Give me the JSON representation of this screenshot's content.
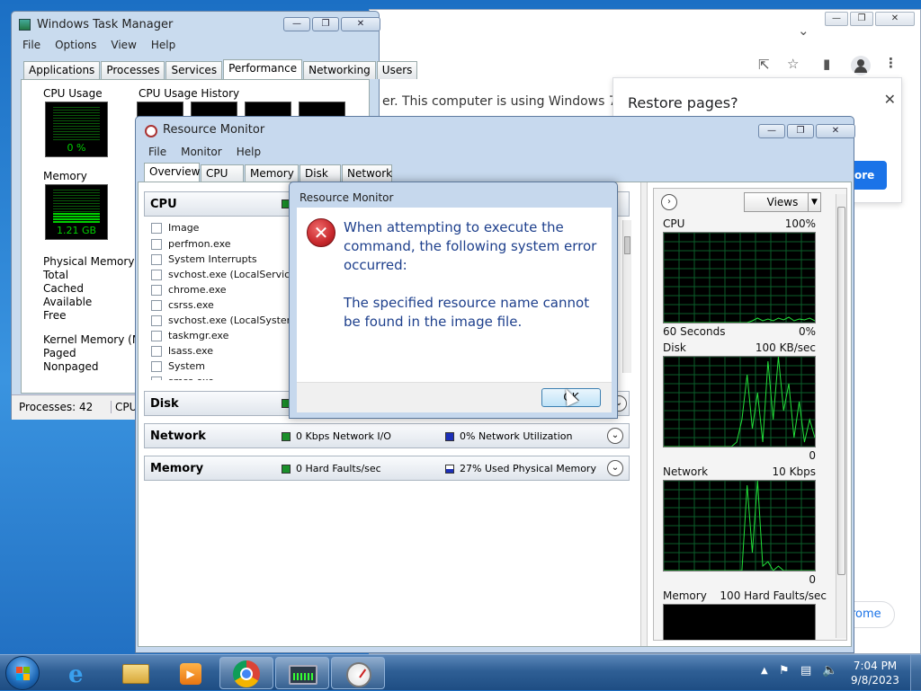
{
  "chrome": {
    "page_text": "er. This computer is using Windows 7.",
    "restore_title": "Restore pages?",
    "restore_btn": "ore",
    "bottom_btn": "rome",
    "controls": {
      "min": "—",
      "max": "❐",
      "close": "✕"
    }
  },
  "task_manager": {
    "title": "Windows Task Manager",
    "menu": [
      "File",
      "Options",
      "View",
      "Help"
    ],
    "tabs": [
      "Applications",
      "Processes",
      "Services",
      "Performance",
      "Networking",
      "Users"
    ],
    "active_tab": "Performance",
    "cpu_usage_label": "CPU Usage",
    "cpu_usage_value": "0 %",
    "cpu_history_label": "CPU Usage History",
    "memory_label": "Memory",
    "memory_value": "1.21 GB",
    "physical_memory": {
      "label": "Physical Memory (MB)",
      "rows": [
        "Total",
        "Cached",
        "Available",
        "Free"
      ]
    },
    "kernel_memory": {
      "label": "Kernel Memory (MB)",
      "rows": [
        "Paged",
        "Nonpaged"
      ]
    },
    "status_processes": "Processes: 42",
    "status_cpu": "CPU"
  },
  "resource_monitor": {
    "title": "Resource Monitor",
    "menu": [
      "File",
      "Monitor",
      "Help"
    ],
    "tabs": [
      "Overview",
      "CPU",
      "Memory",
      "Disk",
      "Network"
    ],
    "active_tab": "Overview",
    "cpu_section": "CPU",
    "image_col": "Image",
    "processes": [
      "perfmon.exe",
      "System Interrupts",
      "svchost.exe (LocalServiceNo",
      "chrome.exe",
      "csrss.exe",
      "svchost.exe (LocalSystemNe",
      "taskmgr.exe",
      "lsass.exe",
      "System",
      "smss.exe"
    ],
    "disk_section": "Disk",
    "network_section": "Network",
    "network_io": "0 Kbps Network I/O",
    "network_util": "0% Network Utilization",
    "memory_section": "Memory",
    "hard_faults": "0 Hard Faults/sec",
    "used_phys": "27% Used Physical Memory",
    "views_btn": "Views",
    "graphs": [
      {
        "name": "CPU",
        "scale": "100%",
        "bottom_left": "60 Seconds",
        "bottom_right": "0%"
      },
      {
        "name": "Disk",
        "scale": "100 KB/sec",
        "bottom_left": "",
        "bottom_right": "0"
      },
      {
        "name": "Network",
        "scale": "10 Kbps",
        "bottom_left": "",
        "bottom_right": "0"
      },
      {
        "name": "Memory",
        "scale": "100 Hard Faults/sec",
        "bottom_left": "",
        "bottom_right": ""
      }
    ]
  },
  "dialog": {
    "title": "Resource Monitor",
    "message1": "When attempting to execute the command, the following system error occurred:",
    "message2": "The specified resource name cannot be found in the image file.",
    "ok": "OK"
  },
  "taskbar": {
    "time": "7:04 PM",
    "date": "9/8/2023"
  },
  "colors": {
    "green": "#00d000",
    "error_red": "#c8282d",
    "text_blue": "#1d3f8c"
  }
}
